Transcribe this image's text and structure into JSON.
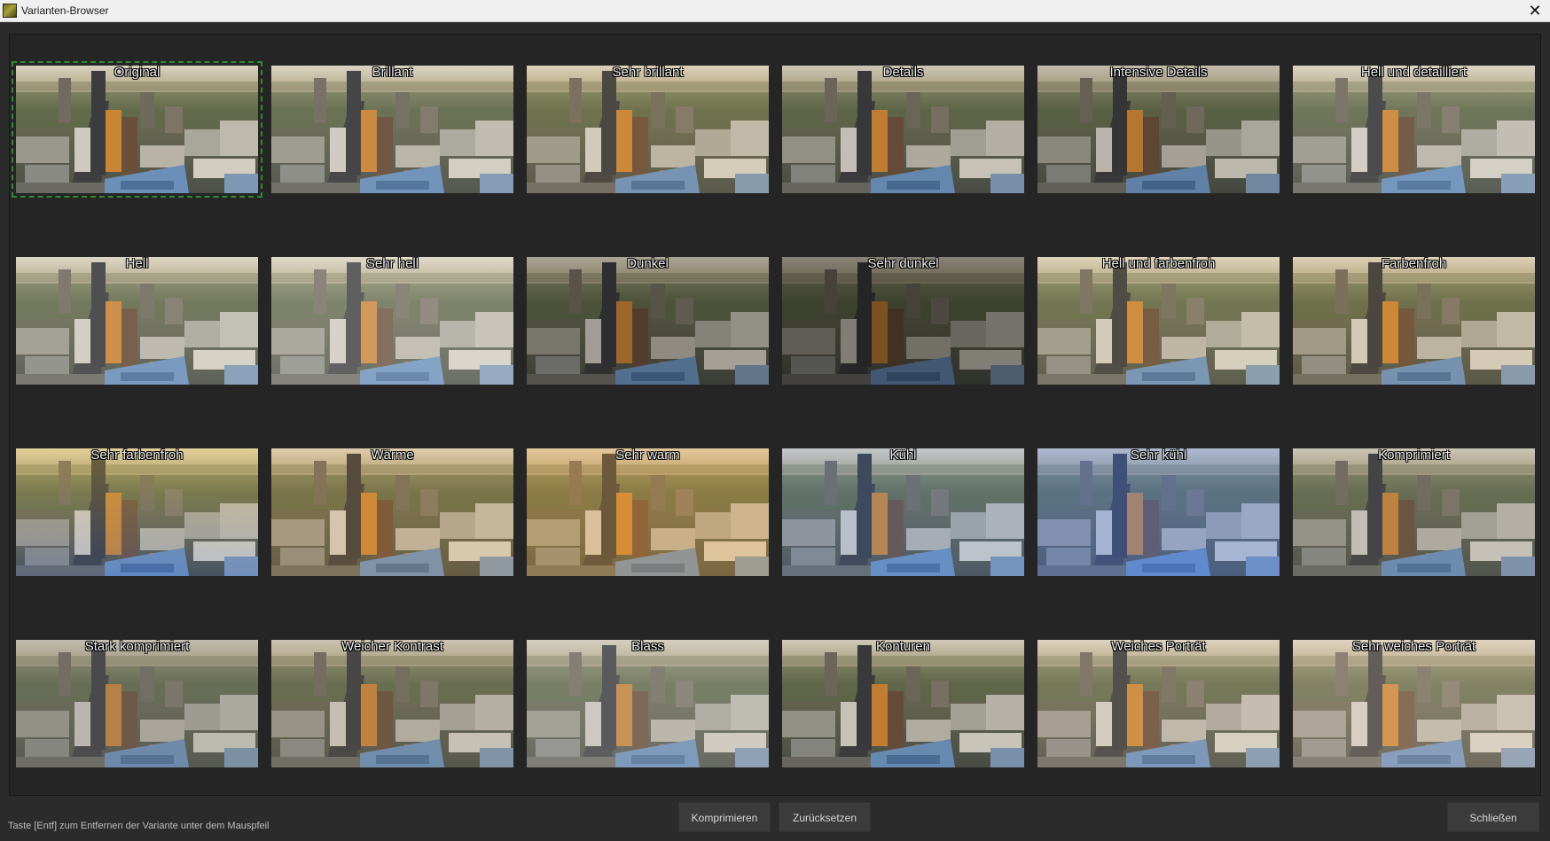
{
  "window": {
    "title": "Varianten-Browser"
  },
  "variants": [
    {
      "label": "Original",
      "selected": true
    },
    {
      "label": "Brillant"
    },
    {
      "label": "Sehr brillant"
    },
    {
      "label": "Details"
    },
    {
      "label": "Intensive Details"
    },
    {
      "label": "Hell und detailliert"
    },
    {
      "label": "Hell"
    },
    {
      "label": "Sehr hell"
    },
    {
      "label": "Dunkel"
    },
    {
      "label": "Sehr dunkel"
    },
    {
      "label": "Hell und farbenfroh"
    },
    {
      "label": "Farbenfroh"
    },
    {
      "label": "Sehr farbenfroh"
    },
    {
      "label": "Wärme"
    },
    {
      "label": "Sehr warm"
    },
    {
      "label": "Kühl"
    },
    {
      "label": "Sehr kühl"
    },
    {
      "label": "Komprimiert"
    },
    {
      "label": "Stark komprimiert"
    },
    {
      "label": "Weicher Kontrast"
    },
    {
      "label": "Blass"
    },
    {
      "label": "Konturen"
    },
    {
      "label": "Weiches Porträt"
    },
    {
      "label": "Sehr weiches Porträt"
    }
  ],
  "footer": {
    "hint": "Taste [Entf] zum Entfernen der Variante unter dem Mauspfeil",
    "compress_label": "Komprimieren",
    "reset_label": "Zurücksetzen",
    "close_label": "Schließen"
  },
  "colors": {
    "window_bg": "#2b2b2b",
    "panel_bg": "#252525",
    "selection": "#2f8a2f",
    "button_bg": "#3b3b3b"
  },
  "icons": {
    "app": "app-icon",
    "close": "close-icon"
  }
}
